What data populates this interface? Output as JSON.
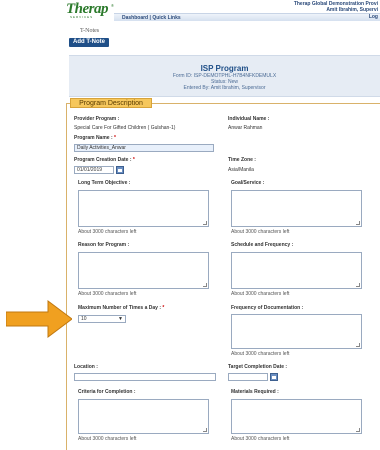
{
  "header": {
    "logo_text": "Therap",
    "logo_sub": "SERVICES",
    "logo_reg": "®",
    "nav": [
      "Dashboard",
      "Quick Links"
    ],
    "nav_separator": "|",
    "org": "Therap Global Demonstration Provi",
    "user": "Amit Ibrahim, Supervi",
    "logout": "Log"
  },
  "module": "T-Notes",
  "add_button": "Add T-Note",
  "program": {
    "title": "ISP Program",
    "form_id": "Form ID: ISP-DEMOTPHL-H7B4NFKDEMULX",
    "status": "Status: New",
    "entered_by": "Entered By: Amit Ibrahim, Supervisor"
  },
  "form": {
    "legend": "Program Description",
    "provider_program_label": "Provider Program :",
    "provider_program_value": "Special Care For Gifted Children ( Gulshan-1)",
    "individual_name_label": "Individual Name :",
    "individual_name_value": "Anwar Rahman",
    "program_name_label": "Program Name :",
    "program_name_value": "Daily Activities_Anwar",
    "creation_date_label": "Program Creation Date :",
    "creation_date_value": "01/01/2019",
    "time_zone_label": "Time Zone :",
    "time_zone_value": "Asia/Manila",
    "long_term_label": "Long Term Objective :",
    "goal_label": "Goal/Service :",
    "reason_label": "Reason for Program :",
    "schedule_label": "Schedule and Frequency :",
    "max_times_label": "Maximum Number of Times a Day :",
    "max_times_value": "10",
    "freq_doc_label": "Frequency of Documentation :",
    "location_label": "Location :",
    "completion_date_label": "Target Completion Date :",
    "criteria_label": "Criteria for Completion :",
    "materials_label": "Materials Required :",
    "chars_left": "About 3000 characters left",
    "required_mark": "*"
  },
  "colors": {
    "brand_green": "#2c7a2c",
    "nav_blue": "#1f4f88",
    "legend_orange": "#f6c75c",
    "arrow_orange": "#f0a020"
  },
  "icons": [
    "calendar-icon",
    "chevron-down-icon",
    "pointer-arrow"
  ]
}
